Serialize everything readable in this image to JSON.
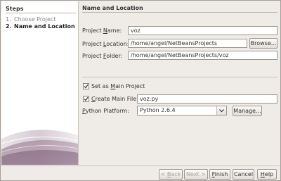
{
  "steps": {
    "title": "Steps",
    "items": [
      {
        "num": "1.",
        "label": "Choose Project"
      },
      {
        "num": "2.",
        "label": "Name and Location"
      }
    ]
  },
  "panel": {
    "title": "Name and Location"
  },
  "form": {
    "project_name": {
      "label": "Project Name:",
      "label_pre": "Project ",
      "label_u": "N",
      "label_post": "ame:",
      "value": "voz"
    },
    "project_location": {
      "label": "Project Location:",
      "label_pre": "Project ",
      "label_u": "L",
      "label_post": "ocation:",
      "value": "/home/angel/NetBeansProjects",
      "browse": "Browse..."
    },
    "project_folder": {
      "label": "Project Folder:",
      "label_pre": "Project ",
      "label_u": "F",
      "label_post": "older:",
      "value": "/home/angel/NetBeansProjects/voz"
    },
    "set_main": {
      "label": "Set as Main Project",
      "label_pre": "Set as ",
      "label_u": "M",
      "label_post": "ain Project",
      "checked": true
    },
    "create_main": {
      "label": "Create Main File",
      "label_pre": "",
      "label_u": "C",
      "label_post": "reate Main File",
      "checked": true,
      "value": "voz.py"
    },
    "python_platform": {
      "label": "Python Platform:",
      "label_pre": "",
      "label_u": "P",
      "label_post": "ython Platform:",
      "value": "Python 2.6.4",
      "manage": "Manage..."
    }
  },
  "footer": {
    "back": {
      "pre": "< ",
      "u": "B",
      "post": "ack"
    },
    "next": "Next >",
    "finish": {
      "u": "F",
      "post": "inish"
    },
    "cancel": "Cancel",
    "help": {
      "u": "H",
      "post": "elp"
    }
  }
}
